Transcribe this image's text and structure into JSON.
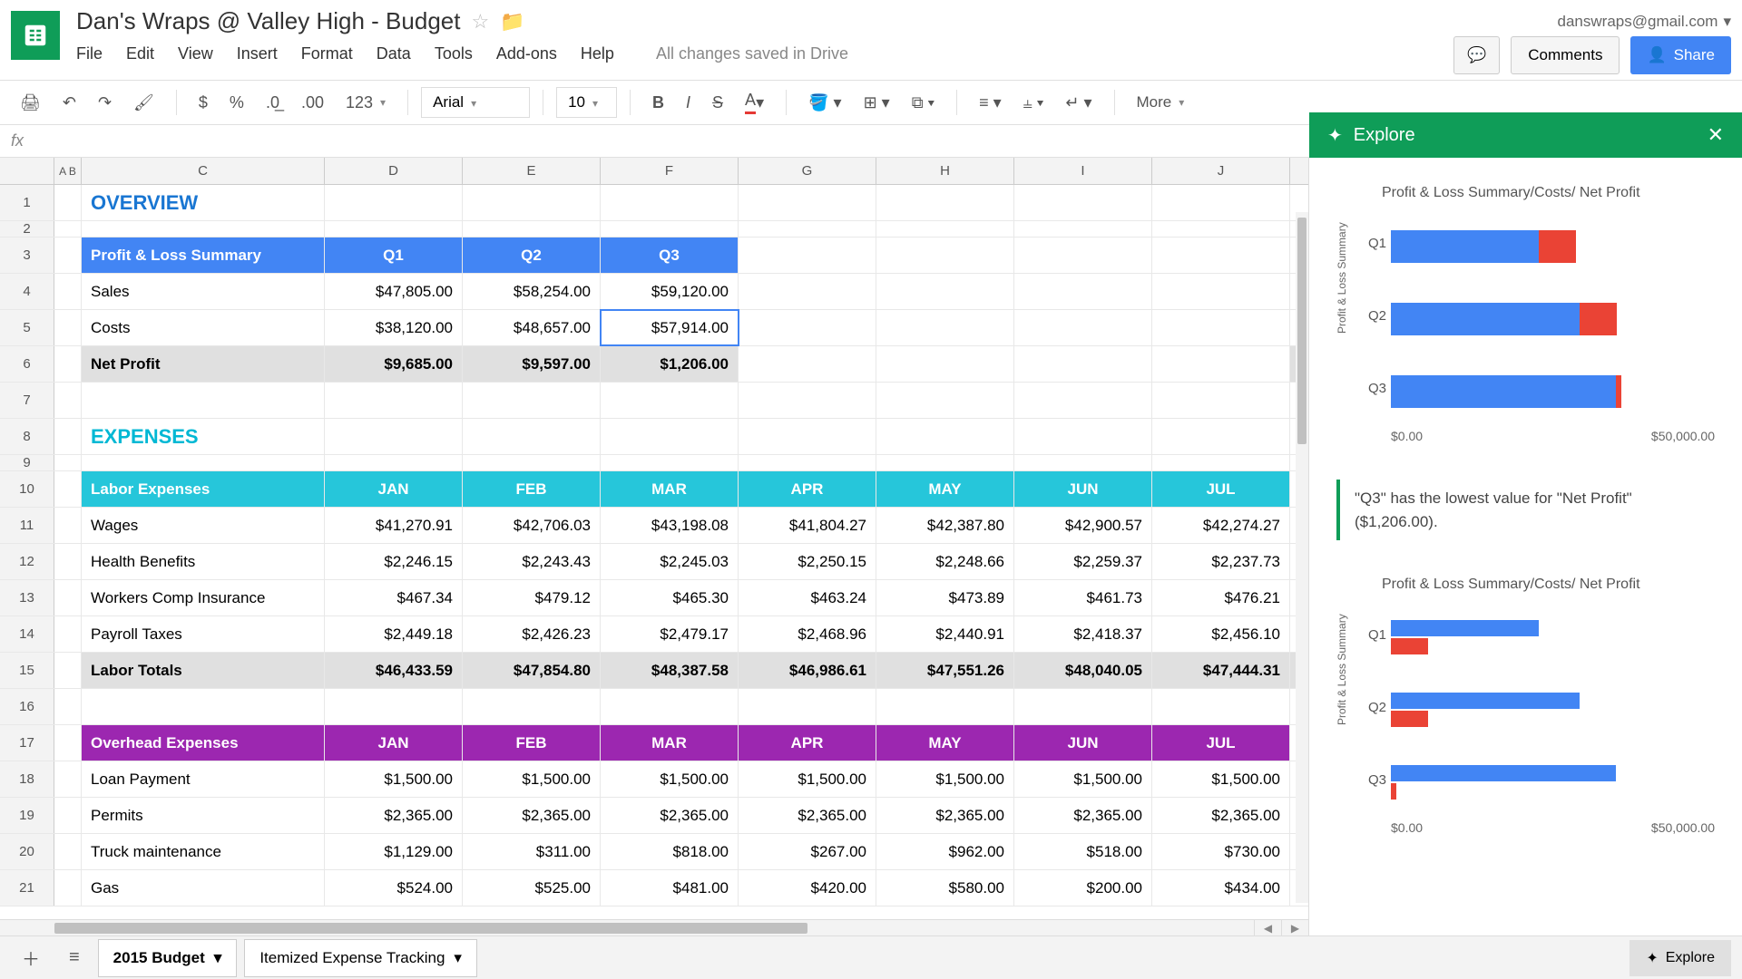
{
  "doc_title": "Dan's Wraps @ Valley High - Budget",
  "user_email": "danswraps@gmail.com",
  "menu": [
    "File",
    "Edit",
    "View",
    "Insert",
    "Format",
    "Data",
    "Tools",
    "Add-ons",
    "Help"
  ],
  "save_status": "All changes saved in Drive",
  "btn_comments": "Comments",
  "btn_share": "Share",
  "toolbar": {
    "font": "Arial",
    "font_size": "10",
    "more": "More"
  },
  "columns": [
    "A",
    "B",
    "C",
    "D",
    "E",
    "F",
    "G",
    "H",
    "I",
    "J"
  ],
  "sections": {
    "overview": "OVERVIEW",
    "expenses": "EXPENSES"
  },
  "pl_header": {
    "label": "Profit & Loss Summary",
    "q1": "Q1",
    "q2": "Q2",
    "q3": "Q3"
  },
  "pl": {
    "sales": {
      "label": "Sales",
      "q1": "$47,805.00",
      "q2": "$58,254.00",
      "q3": "$59,120.00"
    },
    "costs": {
      "label": "Costs",
      "q1": "$38,120.00",
      "q2": "$48,657.00",
      "q3": "$57,914.00"
    },
    "profit": {
      "label": "Net Profit",
      "q1": "$9,685.00",
      "q2": "$9,597.00",
      "q3": "$1,206.00"
    }
  },
  "labor_header": {
    "label": "Labor Expenses",
    "cols": [
      "JAN",
      "FEB",
      "MAR",
      "APR",
      "MAY",
      "JUN",
      "JUL"
    ]
  },
  "labor": {
    "wages": {
      "label": "Wages",
      "v": [
        "$41,270.91",
        "$42,706.03",
        "$43,198.08",
        "$41,804.27",
        "$42,387.80",
        "$42,900.57",
        "$42,274.27"
      ]
    },
    "health": {
      "label": "Health Benefits",
      "v": [
        "$2,246.15",
        "$2,243.43",
        "$2,245.03",
        "$2,250.15",
        "$2,248.66",
        "$2,259.37",
        "$2,237.73"
      ]
    },
    "workers": {
      "label": "Workers Comp Insurance",
      "v": [
        "$467.34",
        "$479.12",
        "$465.30",
        "$463.24",
        "$473.89",
        "$461.73",
        "$476.21"
      ]
    },
    "payroll": {
      "label": "Payroll Taxes",
      "v": [
        "$2,449.18",
        "$2,426.23",
        "$2,479.17",
        "$2,468.96",
        "$2,440.91",
        "$2,418.37",
        "$2,456.10"
      ]
    },
    "total": {
      "label": "Labor Totals",
      "v": [
        "$46,433.59",
        "$47,854.80",
        "$48,387.58",
        "$46,986.61",
        "$47,551.26",
        "$48,040.05",
        "$47,444.31"
      ]
    }
  },
  "overhead_header": {
    "label": "Overhead Expenses",
    "cols": [
      "JAN",
      "FEB",
      "MAR",
      "APR",
      "MAY",
      "JUN",
      "JUL"
    ]
  },
  "overhead": {
    "loan": {
      "label": "Loan Payment",
      "v": [
        "$1,500.00",
        "$1,500.00",
        "$1,500.00",
        "$1,500.00",
        "$1,500.00",
        "$1,500.00",
        "$1,500.00"
      ]
    },
    "permits": {
      "label": "Permits",
      "v": [
        "$2,365.00",
        "$2,365.00",
        "$2,365.00",
        "$2,365.00",
        "$2,365.00",
        "$2,365.00",
        "$2,365.00"
      ]
    },
    "truck": {
      "label": "Truck maintenance",
      "v": [
        "$1,129.00",
        "$311.00",
        "$818.00",
        "$267.00",
        "$962.00",
        "$518.00",
        "$730.00"
      ]
    },
    "gas": {
      "label": "Gas",
      "v": [
        "$524.00",
        "$525.00",
        "$481.00",
        "$420.00",
        "$580.00",
        "$200.00",
        "$434.00"
      ]
    }
  },
  "explore": {
    "title": "Explore",
    "chart_title": "Profit & Loss Summary/Costs/ Net Profit",
    "insight": "\"Q3\" has the lowest value for \"Net Profit\" ($1,206.00).",
    "axis0": "$0.00",
    "axis50": "$50,000.00",
    "ylabel": "Profit & Loss Summary"
  },
  "chart_data": [
    {
      "type": "bar",
      "orientation": "horizontal",
      "stacked": true,
      "title": "Profit & Loss Summary/Costs/ Net Profit",
      "categories": [
        "Q1",
        "Q2",
        "Q3"
      ],
      "series": [
        {
          "name": "Costs",
          "color": "#4285f4",
          "values": [
            38120,
            48657,
            57914
          ]
        },
        {
          "name": "Net Profit",
          "color": "#ea4335",
          "values": [
            9685,
            9597,
            1206
          ]
        }
      ],
      "xlim": [
        0,
        60000
      ],
      "xlabel": "",
      "ylabel": "Profit & Loss Summary"
    },
    {
      "type": "bar",
      "orientation": "horizontal",
      "stacked": false,
      "title": "Profit & Loss Summary/Costs/ Net Profit",
      "categories": [
        "Q1",
        "Q2",
        "Q3"
      ],
      "series": [
        {
          "name": "Costs",
          "color": "#4285f4",
          "values": [
            38120,
            48657,
            57914
          ]
        },
        {
          "name": "Net Profit",
          "color": "#ea4335",
          "values": [
            9685,
            9597,
            1206
          ]
        }
      ],
      "xlim": [
        0,
        60000
      ],
      "xlabel": "",
      "ylabel": "Profit & Loss Summary"
    }
  ],
  "tabs": {
    "t1": "2015 Budget",
    "t2": "Itemized Expense Tracking"
  },
  "explore_btn": "Explore"
}
